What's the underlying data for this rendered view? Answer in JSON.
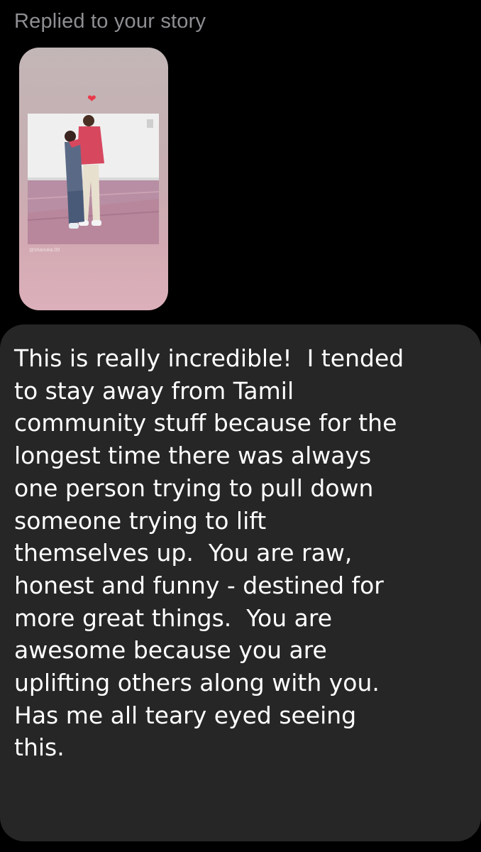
{
  "reply_header": {
    "label": "Replied to your story"
  },
  "story": {
    "heart_icon": "heart-icon",
    "mention": "@shanuka.00",
    "accent_color": "#e83a4b"
  },
  "message": {
    "bubble_color": "#262626",
    "lines": [
      "This is really incredible!  I tended",
      "to stay away from Tamil",
      "community stuff because for the",
      "longest time there was always",
      "one person trying to pull down",
      "someone trying to lift",
      "themselves up.  You are raw,",
      "honest and funny - destined for",
      "more great things.  You are",
      "awesome because you are",
      "uplifting others along with you.",
      "Has me all teary eyed seeing",
      "this."
    ]
  }
}
